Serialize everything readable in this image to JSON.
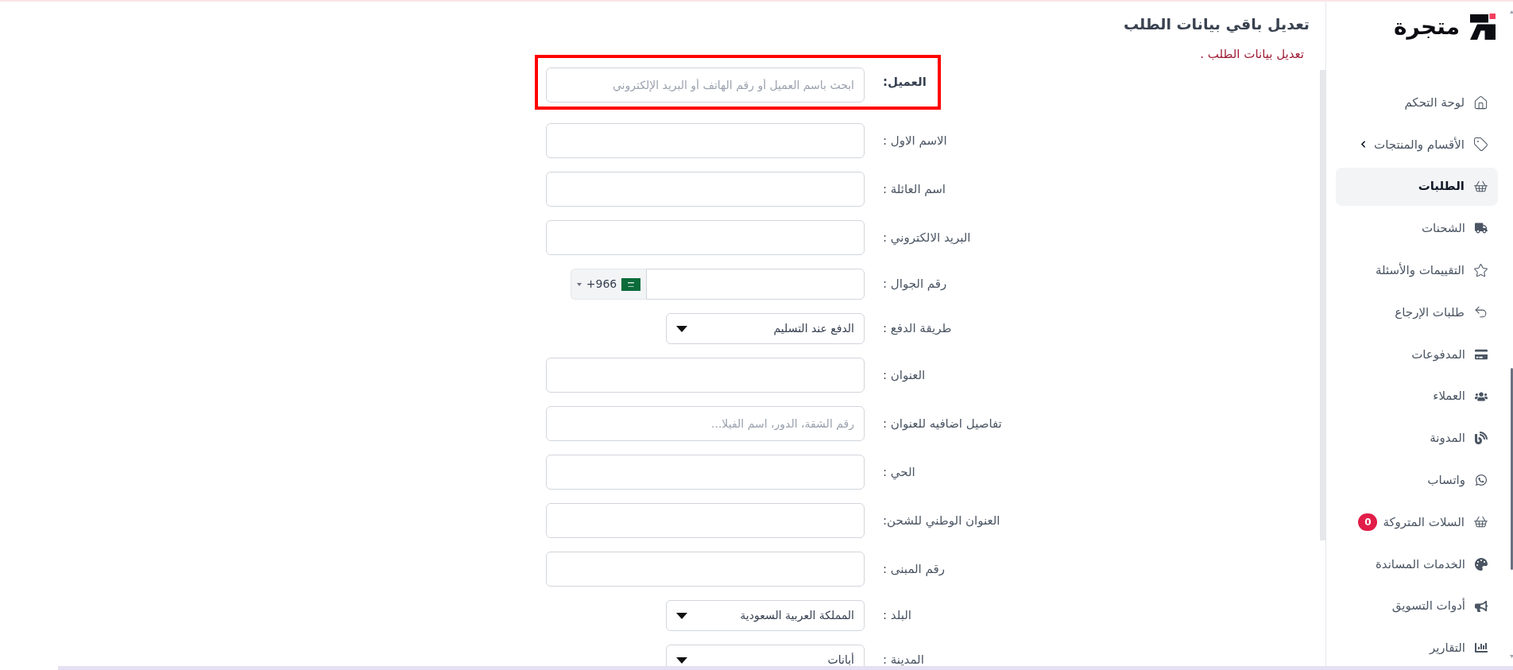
{
  "sidebar": {
    "logo": {
      "text": "متجرة"
    },
    "items": [
      {
        "label": "لوحة التحكم",
        "kind": "link",
        "selected": false
      },
      {
        "label": "الأقسام والمنتجات",
        "kind": "submenu",
        "selected": false
      },
      {
        "label": "الطلبات",
        "kind": "link",
        "selected": true
      },
      {
        "label": "الشحنات",
        "kind": "link",
        "selected": false
      },
      {
        "label": "التقييمات والأسئلة",
        "kind": "link",
        "selected": false
      },
      {
        "label": "طلبات الإرجاع",
        "kind": "link",
        "selected": false
      },
      {
        "label": "المدفوعات",
        "kind": "link",
        "selected": false
      },
      {
        "label": "العملاء",
        "kind": "link",
        "selected": false
      },
      {
        "label": "المدونة",
        "kind": "link",
        "selected": false
      },
      {
        "label": "واتساب",
        "kind": "link",
        "selected": false
      },
      {
        "label": "السلات المتروكة",
        "kind": "link",
        "selected": false,
        "badge": "0"
      },
      {
        "label": "الخدمات المساندة",
        "kind": "link",
        "selected": false
      },
      {
        "label": "أدوات التسويق",
        "kind": "link",
        "selected": false
      },
      {
        "label": "التقارير",
        "kind": "link",
        "selected": false
      }
    ]
  },
  "page": {
    "title": "تعديل باقي بيانات الطلب",
    "subtitle": "تعديل بيانات الطلب ."
  },
  "form": {
    "fields": [
      {
        "label": "العميل:",
        "kind": "search",
        "placeholder": "ابحث باسم العميل أو رقم الهاتف أو البريد الإلكتروني",
        "highlighted": true
      },
      {
        "label": "الاسم الاول :",
        "kind": "text",
        "highlighted": false
      },
      {
        "label": "اسم العائلة :",
        "kind": "text",
        "highlighted": false
      },
      {
        "label": "البريد الالكتروني :",
        "kind": "text",
        "highlighted": false
      },
      {
        "label": "رقم الجوال :",
        "kind": "phone",
        "country_code": "+966",
        "highlighted": false
      },
      {
        "label": "طريقة الدفع :",
        "kind": "select",
        "value": "الدفع عند التسليم",
        "highlighted": false
      },
      {
        "label": "العنوان :",
        "kind": "text",
        "highlighted": false
      },
      {
        "label": "تفاصيل اضافيه للعنوان :",
        "kind": "text",
        "placeholder": "رقم الشقة، الدور، اسم الفيلا...",
        "highlighted": false
      },
      {
        "label": "الحي :",
        "kind": "text",
        "highlighted": false
      },
      {
        "label": "العنوان الوطني للشحن:",
        "kind": "text",
        "highlighted": false
      },
      {
        "label": "رقم المبنى :",
        "kind": "text",
        "highlighted": false
      },
      {
        "label": "البلد :",
        "kind": "select",
        "value": "المملكة العربية السعودية",
        "highlighted": false
      },
      {
        "label": "المدينة :",
        "kind": "select",
        "value": "أبانات",
        "highlighted": false
      }
    ]
  }
}
